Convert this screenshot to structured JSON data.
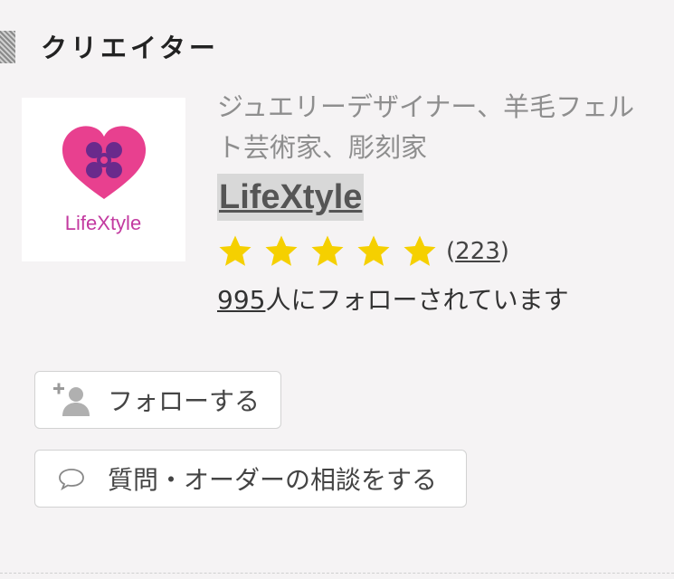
{
  "section": {
    "title": "クリエイター"
  },
  "creator": {
    "role": "ジュエリーデザイナー、羊毛フェルト芸術家、彫刻家",
    "name": "LifeXtyle",
    "logo_text": "LifeXtyle",
    "rating_stars": 5,
    "review_open": "(",
    "review_count": "223",
    "review_close": ")",
    "follower_count": "995",
    "follower_suffix": "人にフォローされています"
  },
  "buttons": {
    "follow_label": "フォローする",
    "ask_label": "質問・オーダーの相談をする"
  },
  "colors": {
    "star": "#f5d000",
    "heart": "#e8408f",
    "logo_x": "#6a2a8c",
    "logo_text": "#c33aa0"
  },
  "icons": {
    "star": "star-icon",
    "follow": "add-user-icon",
    "ask": "speech-bubble-icon"
  }
}
